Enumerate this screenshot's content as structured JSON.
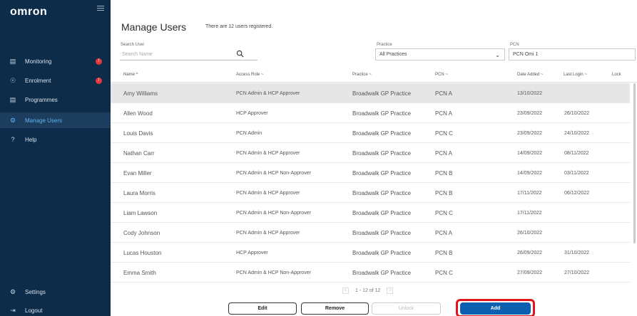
{
  "brand": {
    "logo": "omron"
  },
  "sidebar": {
    "items": [
      {
        "label": "Monitoring",
        "icon": "monitor-icon",
        "badge": "!"
      },
      {
        "label": "Enrolment",
        "icon": "enrolment-icon",
        "badge": "!"
      },
      {
        "label": "Programmes",
        "icon": "programmes-icon"
      },
      {
        "label": "Manage Users",
        "icon": "manage-users-icon"
      },
      {
        "label": "Help",
        "icon": "help-icon"
      }
    ],
    "bottom": [
      {
        "label": "Settings",
        "icon": "gear-icon"
      },
      {
        "label": "Logout",
        "icon": "logout-icon"
      }
    ]
  },
  "header": {
    "title": "Manage Users",
    "subtitle": "There are 12 users registered."
  },
  "filters": {
    "search_label": "Search User",
    "search_placeholder": "Search Name",
    "practice_label": "Practice",
    "practice_value": "All Practices",
    "pcn_label": "PCN",
    "pcn_value": "PCN Omi 1"
  },
  "table": {
    "columns": [
      "Name ^",
      "Access Role ~",
      "Practice ~",
      "PCN ~",
      "Date Added ~",
      "Last Login ~",
      "Lock"
    ],
    "rows": [
      [
        "Amy Williams",
        "PCN Admin & HCP Approver",
        "Broadwalk GP Practice",
        "PCN A",
        "13/10/2022",
        ""
      ],
      [
        "Allen Wood",
        "HCP Approver",
        "Broadwalk GP Practice",
        "PCN A",
        "23/09/2022",
        "26/10/2022"
      ],
      [
        "Louis Davis",
        "PCN Admin",
        "Broadwalk GP Practice",
        "PCN C",
        "23/09/2022",
        "24/10/2022"
      ],
      [
        "Nathan Carr",
        "PCN Admin & HCP Approver",
        "Broadwalk GP Practice",
        "PCN A",
        "14/09/2022",
        "08/11/2022"
      ],
      [
        "Evan Miller",
        "PCN Admin & HCP Non-Approver",
        "Broadwalk GP Practice",
        "PCN B",
        "14/09/2022",
        "03/11/2022"
      ],
      [
        "Laura Morris",
        "PCN Admin & HCP Approver",
        "Broadwalk GP Practice",
        "PCN B",
        "17/11/2022",
        "06/12/2022"
      ],
      [
        "Liam Lawson",
        "PCN Admin & HCP Non-Approver",
        "Broadwalk GP Practice",
        "PCN C",
        "17/11/2022",
        ""
      ],
      [
        "Cody Johnson",
        "PCN Admin & HCP Approver",
        "Broadwalk GP Practice",
        "PCN A",
        "26/10/2022",
        ""
      ],
      [
        "Lucas Houston",
        "HCP Approver",
        "Broadwalk GP Practice",
        "PCN B",
        "26/09/2022",
        "31/10/2022"
      ],
      [
        "Emma Smith",
        "PCN Admin & HCP Non-Approver",
        "Broadwalk GP Practice",
        "PCN C",
        "27/09/2022",
        "27/10/2022"
      ]
    ]
  },
  "pagination": {
    "prev": "<",
    "text": "1 - 12 of 12",
    "next": ">"
  },
  "actions": {
    "edit": "Edit",
    "remove": "Remove",
    "unlock": "Unlock",
    "add": "Add"
  },
  "colors": {
    "sidebar": "#0d2c4a",
    "accent": "#0d5fb0",
    "highlight": "#e0161e",
    "badge": "#e03a3e"
  }
}
